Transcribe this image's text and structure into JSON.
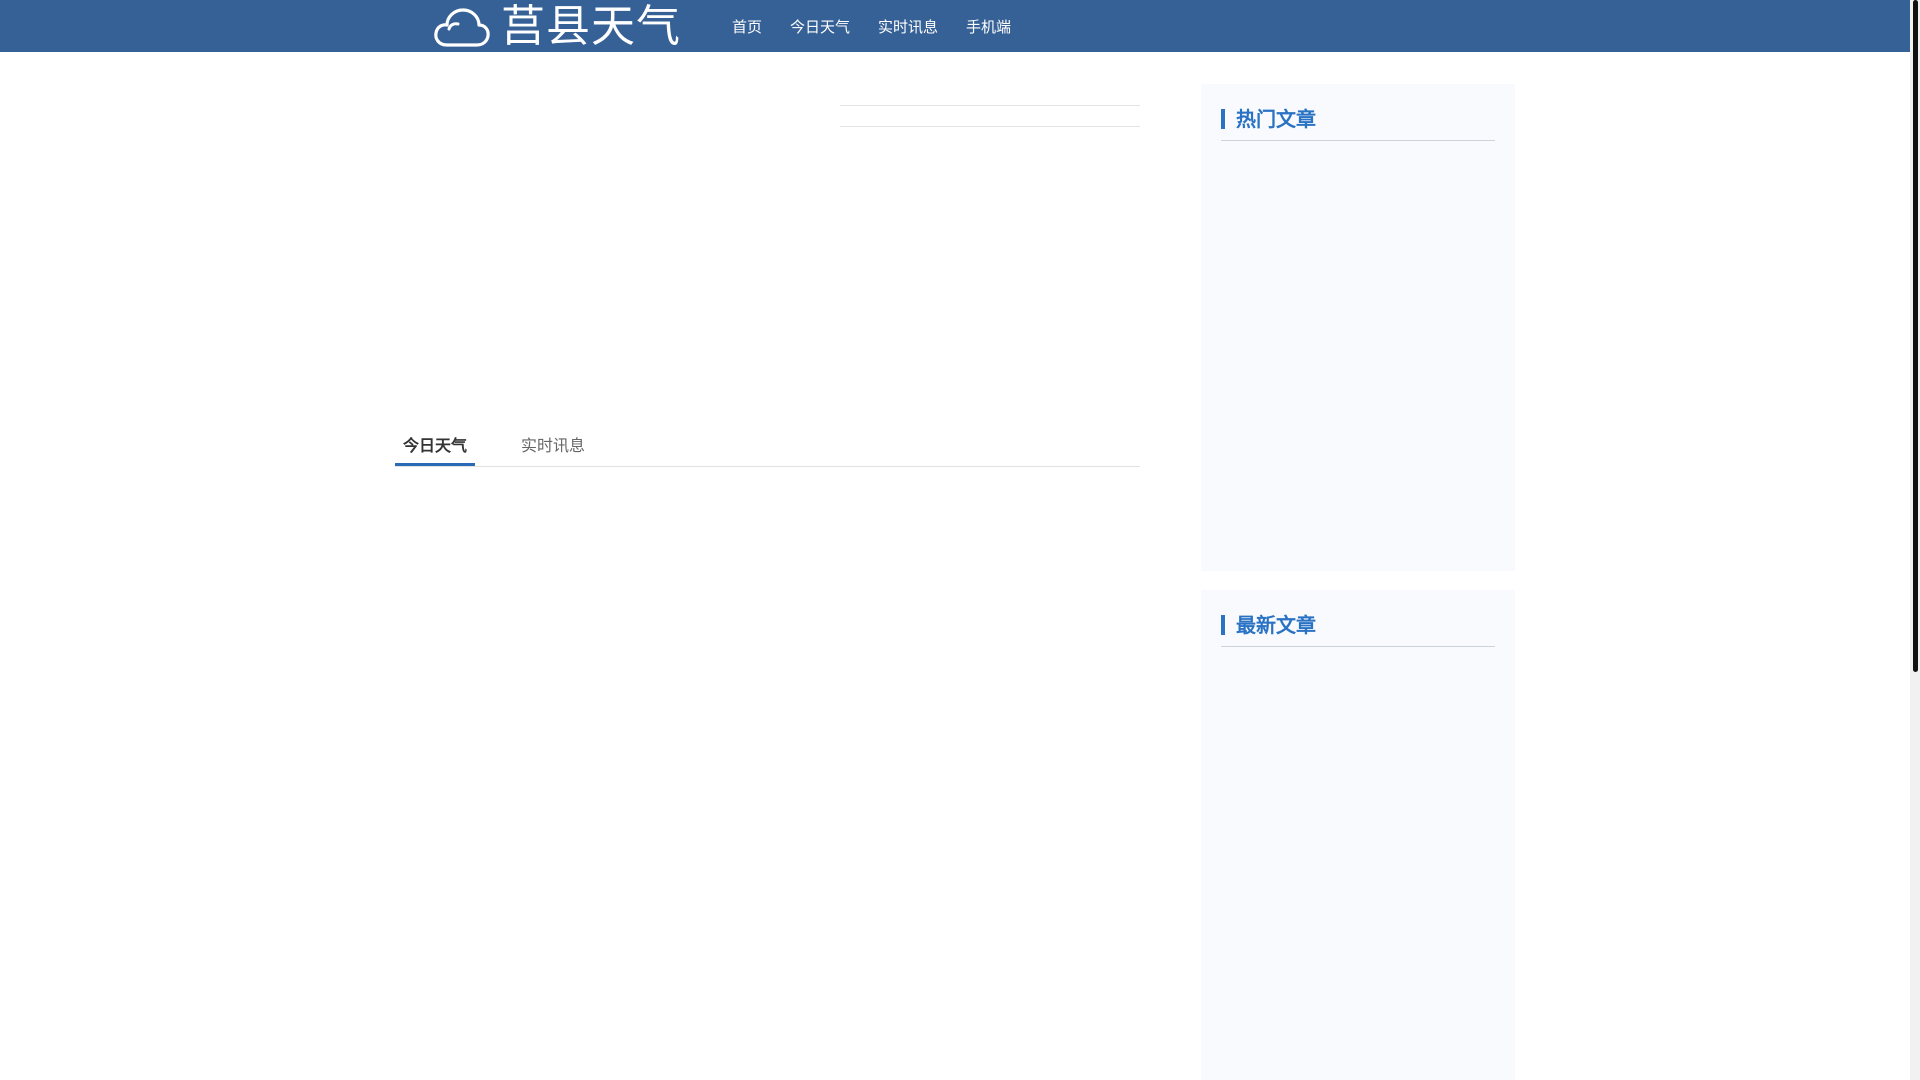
{
  "header": {
    "logo_text": "莒县天气",
    "logo_icon": "cloud-icon",
    "nav": [
      {
        "label": "首页"
      },
      {
        "label": "今日天气"
      },
      {
        "label": "实时讯息"
      },
      {
        "label": "手机端"
      }
    ]
  },
  "main": {
    "tabs": [
      {
        "label": "今日天气",
        "active": true
      },
      {
        "label": "实时讯息",
        "active": false
      }
    ]
  },
  "sidebar": {
    "hot_title": "热门文章",
    "latest_title": "最新文章"
  },
  "colors": {
    "header_bg": "#366196",
    "accent": "#2a73c4",
    "sidebar_bg": "#f8fafd"
  }
}
